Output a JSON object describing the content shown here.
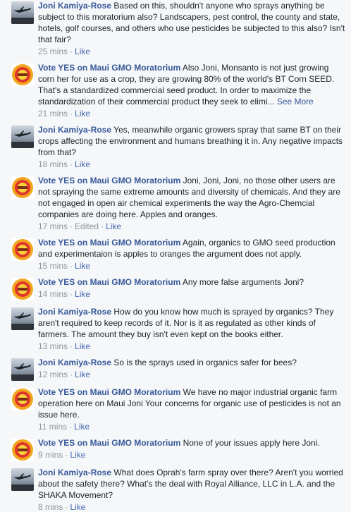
{
  "comments": [
    {
      "author": "Joni Kamiya-Rose",
      "avatar": "joni",
      "text": "Based on this, shouldn't anyone who sprays anything be subject to this moratorium also? Landscapers, pest control, the county and state, hotels, golf courses, and others who use pesticides be subjected to this also? Isn't that fair?",
      "time": "25 mins",
      "like": "Like"
    },
    {
      "author": "Vote YES on Maui GMO Moratorium",
      "avatar": "gmo",
      "text": "Also Joni, Monsanto is not just growing corn her for use as a crop, they are growing 80% of the world's BT Corn SEED. That's a standardized commercial seed product. In order to maximize the standardization of their commercial product they seek to elimi...",
      "see_more": "See More",
      "time": "21 mins",
      "like": "Like"
    },
    {
      "author": "Joni Kamiya-Rose",
      "avatar": "joni",
      "text": "Yes, meanwhile organic growers spray that same BT on their crops affecting the environment and humans breathing it in. Any negative impacts from that?",
      "time": "18 mins",
      "like": "Like"
    },
    {
      "author": "Vote YES on Maui GMO Moratorium",
      "avatar": "gmo",
      "text": "Joni, Joni, Joni, no those other users are not spraying the same extreme amounts and diversity of chemicals. And they are not engaged in open air chemical experiments the way the Agro-Chemcial companies are doing here. Apples and oranges.",
      "time": "17 mins",
      "edited": "Edited",
      "like": "Like"
    },
    {
      "author": "Vote YES on Maui GMO Moratorium",
      "avatar": "gmo",
      "text": "Again, organics to GMO seed production and experimentaion is apples to oranges the argument does not apply.",
      "time": "15 mins",
      "like": "Like"
    },
    {
      "author": "Vote YES on Maui GMO Moratorium",
      "avatar": "gmo",
      "text": "Any more false arguments Joni?",
      "time": "14 mins",
      "like": "Like"
    },
    {
      "author": "Joni Kamiya-Rose",
      "avatar": "joni",
      "text": "How do you know how much is sprayed by organics? They aren't required to keep records of it. Nor is it as regulated as other kinds of farmers. The amount they buy isn't even kept on the books either.",
      "time": "13 mins",
      "like": "Like"
    },
    {
      "author": "Joni Kamiya-Rose",
      "avatar": "joni",
      "text": "So is the sprays used in organics safer for bees?",
      "time": "12 mins",
      "like": "Like"
    },
    {
      "author": "Vote YES on Maui GMO Moratorium",
      "avatar": "gmo",
      "text": "We have no major industrial organic farm operation here on Maui Joni Your concerns for organic use of pesticides is not an issue here.",
      "time": "11 mins",
      "like": "Like"
    },
    {
      "author": "Vote YES on Maui GMO Moratorium",
      "avatar": "gmo",
      "text": "None of your issues apply here Joni.",
      "time": "9 mins",
      "like": "Like"
    },
    {
      "author": "Joni Kamiya-Rose",
      "avatar": "joni",
      "text": "What does Oprah's farm spray over there? Aren't you worried about the safety there? What's the deal with Royal Alliance, LLC in L.A. and the SHAKA Movement?",
      "time": "8 mins",
      "like": "Like"
    }
  ],
  "colors": {
    "author_link": "#365899",
    "action_link": "#4267b2",
    "meta_gray": "#90949c",
    "background": "#f6f7f9"
  }
}
